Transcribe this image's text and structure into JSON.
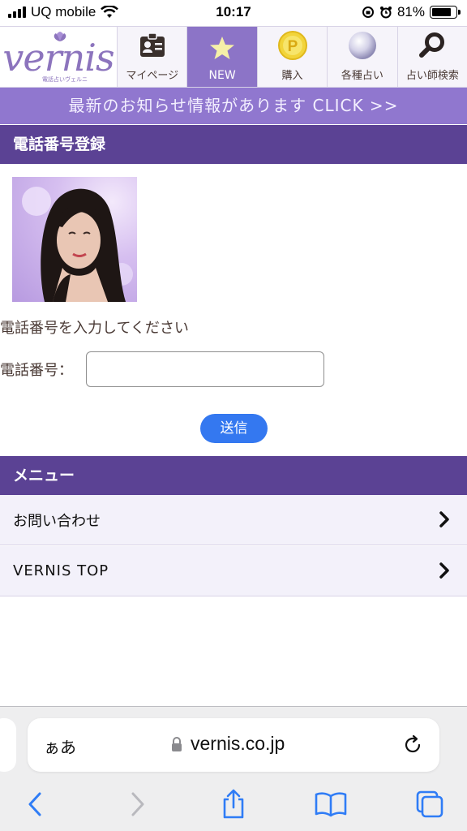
{
  "status_bar": {
    "carrier": "UQ mobile",
    "time": "10:17",
    "battery": "81%",
    "battery_level": 0.81
  },
  "header": {
    "logo_text": "vernis",
    "logo_sub": "電話占いヴェルニ",
    "nav": [
      {
        "label": "マイページ",
        "icon": "id-card-icon"
      },
      {
        "label": "NEW",
        "icon": "star-icon"
      },
      {
        "label": "購入",
        "icon": "coin-icon"
      },
      {
        "label": "各種占い",
        "icon": "crystal-ball-icon"
      },
      {
        "label": "占い師検索",
        "icon": "search-icon"
      }
    ]
  },
  "announcement": "最新のお知らせ情報があります CLICK >>",
  "registration": {
    "title": "電話番号登録",
    "prompt": "電話番号を入力してください",
    "field_label": "電話番号：",
    "field_value": "",
    "submit_label": "送信"
  },
  "menu": {
    "title": "メニュー",
    "items": [
      {
        "label": "お問い合わせ"
      },
      {
        "label": "VERNIS TOP"
      }
    ]
  },
  "browser": {
    "text_size_label": "ぁあ",
    "url": "vernis.co.jp"
  },
  "colors": {
    "header_purple": "#5b4294",
    "accent_purple": "#9077cf",
    "active_nav": "#8c74c7",
    "submit_blue": "#3478f0",
    "ios_blue": "#2f7cf6"
  }
}
